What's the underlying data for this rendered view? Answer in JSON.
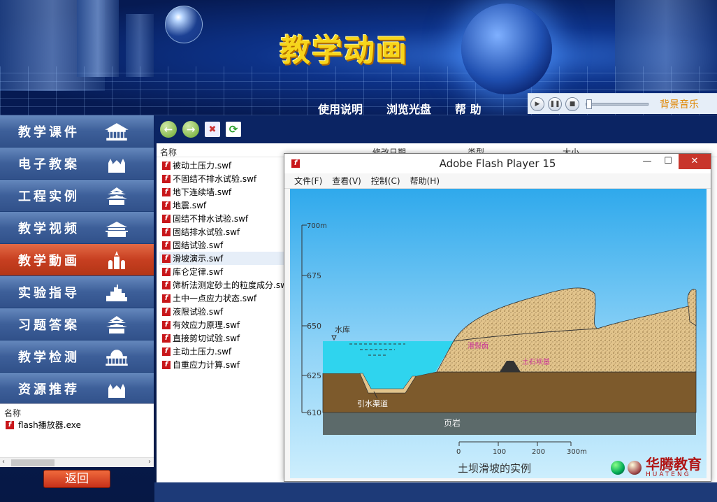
{
  "banner": {
    "title": "教学动画"
  },
  "topnav": {
    "items": [
      "使用说明",
      "浏览光盘",
      "帮 助"
    ]
  },
  "music": {
    "label": "背景音乐"
  },
  "sidebar": {
    "items": [
      {
        "label": "教学课件",
        "icon": "temple-icon"
      },
      {
        "label": "电子教案",
        "icon": "cathedral-icon"
      },
      {
        "label": "工程实例",
        "icon": "pagoda-icon"
      },
      {
        "label": "教学视频",
        "icon": "palace-icon"
      },
      {
        "label": "教学動画",
        "icon": "kremlin-icon",
        "active": true
      },
      {
        "label": "实验指导",
        "icon": "cityscape-icon"
      },
      {
        "label": "习题答案",
        "icon": "pagoda-icon"
      },
      {
        "label": "教学检测",
        "icon": "capitol-icon"
      },
      {
        "label": "资源推荐",
        "icon": "cathedral-icon"
      }
    ]
  },
  "filepane": {
    "header": "名称",
    "file": "flash播放器.exe"
  },
  "back": {
    "label": "返回"
  },
  "explorer": {
    "columns": [
      "名称",
      "修改日期",
      "类型",
      "大小"
    ],
    "files": [
      "被动土压力.swf",
      "不固结不排水试验.swf",
      "地下连续墙.swf",
      "地震.swf",
      "固结不排水试验.swf",
      "固结排水试验.swf",
      "固结试验.swf",
      "滑坡演示.swf",
      "库仑定律.swf",
      "筛析法测定砂土的粒度成分.swf",
      "土中一点应力状态.swf",
      "液限试验.swf",
      "有效应力原理.swf",
      "直接剪切试验.swf",
      "主动土压力.swf",
      "自重应力计算.swf"
    ],
    "selected": 7
  },
  "flash": {
    "title": "Adobe Flash Player 15",
    "menu": [
      "文件(F)",
      "查看(V)",
      "控制(C)",
      "帮助(H)"
    ]
  },
  "chart_data": {
    "type": "diagram",
    "elevations": [
      "700m",
      "675",
      "650",
      "625",
      "610"
    ],
    "labels": {
      "reservoir": "水库",
      "channel": "引水渠道",
      "bedrock": "页岩",
      "slip": "滑裂面",
      "dam": "土石坝基"
    },
    "scale": {
      "ticks": [
        "0",
        "100",
        "200",
        "300m"
      ]
    },
    "caption": "土坝滑坡的实例"
  },
  "logo": {
    "text": "华腾教育",
    "sub": "HUATENG"
  }
}
